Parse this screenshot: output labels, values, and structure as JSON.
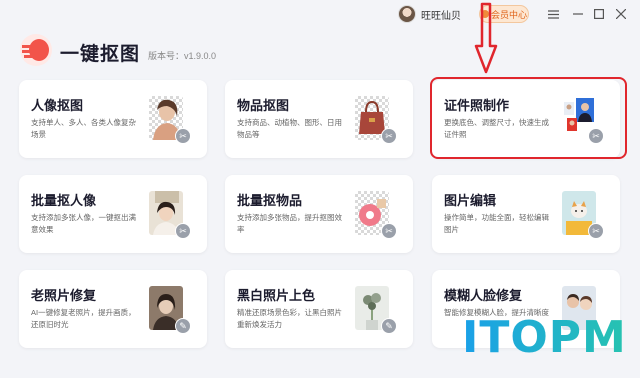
{
  "user": {
    "name": "旺旺仙贝"
  },
  "vip": {
    "label": "会员中心"
  },
  "app": {
    "title": "一键抠图",
    "version": "版本号：v1.9.0.0"
  },
  "cards": [
    {
      "title": "人像抠图",
      "desc": "支持单人、多人、各类人像复杂场景"
    },
    {
      "title": "物品抠图",
      "desc": "支持商品、动植物、图形、日用物品等"
    },
    {
      "title": "证件照制作",
      "desc": "更换底色、调整尺寸，快速生成证件照"
    },
    {
      "title": "批量抠人像",
      "desc": "支持添加多张人像，一键抠出满意效果"
    },
    {
      "title": "批量抠物品",
      "desc": "支持添加多张物品，提升抠图效率"
    },
    {
      "title": "图片编辑",
      "desc": "操作简单，功能全面，轻松编辑图片"
    },
    {
      "title": "老照片修复",
      "desc": "AI一键修复老照片，提升画质，还原旧时光"
    },
    {
      "title": "黑白照片上色",
      "desc": "精准还原场景色彩，让黑白照片重新焕发活力"
    },
    {
      "title": "模糊人脸修复",
      "desc": "智能修复模糊人脸，提升清晰度"
    }
  ],
  "watermark": "ITOPM",
  "colors": {
    "highlight": "#e0262d",
    "accent": "#f2544a",
    "vip": "#e0641b"
  }
}
